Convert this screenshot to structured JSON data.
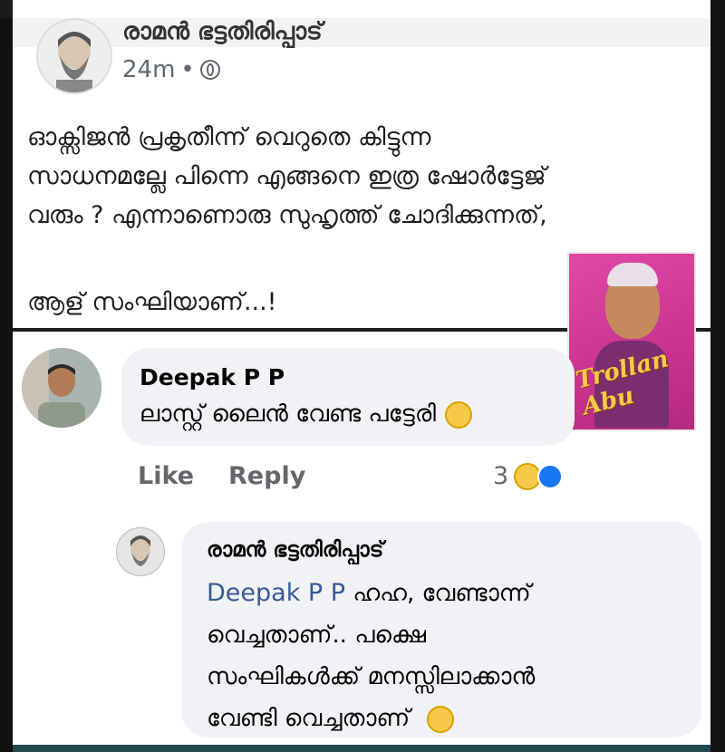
{
  "post": {
    "author": "രാമൻ ഭട്ടതിരിപ്പാട്",
    "time": "24m",
    "separator": "•",
    "more_label": "•••",
    "lines": [
      "ഓക്സിജൻ പ്രകൃതീന്ന് വെറുതെ കിട്ടുന്ന",
      "സാധനമല്ലേ പിന്നെ എങ്ങനെ ഇത്ര ഷോർട്ടേജ്",
      "വരും ? എന്നാണൊരു സുഹൃത്ത് ചോദിക്കുന്നത്,"
    ],
    "last_line": "ആള് സംഘിയാണ്...!"
  },
  "sticker": {
    "logo_text": "Trollan Abu"
  },
  "comment1": {
    "name": "Deepak P P",
    "text": "ലാസ്റ്റ് ലൈൻ വേണ്ട പട്ടേരി",
    "like_label": "Like",
    "reply_label": "Reply",
    "reaction_count": "3"
  },
  "comment2": {
    "name": "രാമൻ ഭട്ടതിരിപ്പാട്",
    "mention": "Deepak P P",
    "line1_rest": "ഹഹ, വേണ്ടാന്ന്",
    "line2": "വെച്ചതാണ്.. പക്ഷെ",
    "line3": "സംഘികൾക്ക് മനസ്സിലാക്കാൻ",
    "line4": "വേണ്ടി വെച്ചതാണ്"
  },
  "colors": {
    "mention": "#385898",
    "bubble": "#f0f2f5",
    "secondary_text": "#65676b"
  }
}
